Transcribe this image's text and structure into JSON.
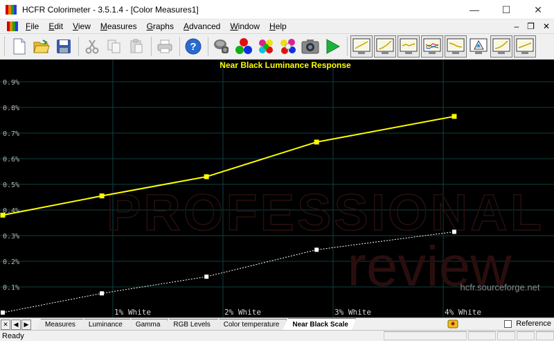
{
  "window": {
    "title": "HCFR Colorimeter - 3.5.1.4 - [Color Measures1]",
    "controls": {
      "minimize": "—",
      "maximize": "☐",
      "close": "✕"
    }
  },
  "menu": {
    "items": [
      {
        "label": "File",
        "key": "F",
        "rest": "ile"
      },
      {
        "label": "Edit",
        "key": "E",
        "rest": "dit"
      },
      {
        "label": "View",
        "key": "V",
        "rest": "iew"
      },
      {
        "label": "Measures",
        "key": "M",
        "rest": "easures"
      },
      {
        "label": "Graphs",
        "key": "G",
        "rest": "raphs"
      },
      {
        "label": "Advanced",
        "key": "A",
        "rest": "dvanced"
      },
      {
        "label": "Window",
        "key": "W",
        "rest": "indow"
      },
      {
        "label": "Help",
        "key": "H",
        "rest": "elp"
      }
    ],
    "mdi": {
      "minimize": "–",
      "restore": "❐",
      "close": "✕"
    }
  },
  "toolbar": {
    "icons": [
      "new-document-icon",
      "open-folder-icon",
      "save-disk-icon",
      "cut-icon",
      "copy-icon",
      "paste-icon",
      "print-icon",
      "help-icon",
      "sensor-icon",
      "rgb-balls-icon",
      "color-balls-icon",
      "color-wheel-balls-icon",
      "camera-icon",
      "play-icon",
      "graph-view-1-icon",
      "graph-view-2-icon",
      "graph-view-3-icon",
      "graph-view-4-icon",
      "graph-view-5-icon",
      "graph-view-6-icon",
      "graph-view-7-icon",
      "graph-view-8-icon"
    ]
  },
  "chart_data": {
    "type": "line",
    "title": "Near Black Luminance Response",
    "x_tick_labels": [
      "1% White",
      "2% White",
      "3% White",
      "4% White"
    ],
    "y_tick_labels": [
      "0.1%",
      "0.2%",
      "0.3%",
      "0.4%",
      "0.5%",
      "0.6%",
      "0.7%",
      "0.8%",
      "0.9%"
    ],
    "ylim": [
      0,
      0.95
    ],
    "xlim": [
      0,
      4.1
    ],
    "grid": true,
    "series": [
      {
        "color": "#ffff00",
        "style": "solid",
        "x": [
          0,
          0.9,
          1.85,
          2.85,
          4.1
        ],
        "y": [
          0.38,
          0.455,
          0.53,
          0.665,
          0.765
        ]
      },
      {
        "color": "#ffffff",
        "style": "dashed",
        "x": [
          0,
          0.9,
          1.85,
          2.85,
          4.1
        ],
        "y": [
          0.0,
          0.075,
          0.14,
          0.245,
          0.315
        ]
      }
    ],
    "watermark": {
      "line1": "PROFESSIONAL",
      "line2": "review",
      "credit": "hcfr.sourceforge.net"
    }
  },
  "tabs": {
    "nav": [
      "✕",
      "◀",
      "▶"
    ],
    "items": [
      "Measures",
      "Luminance",
      "Gamma",
      "RGB Levels",
      "Color temperature",
      "Near Black Scale"
    ],
    "active_index": 5,
    "reference_label": "Reference"
  },
  "status": {
    "text": "Ready"
  }
}
